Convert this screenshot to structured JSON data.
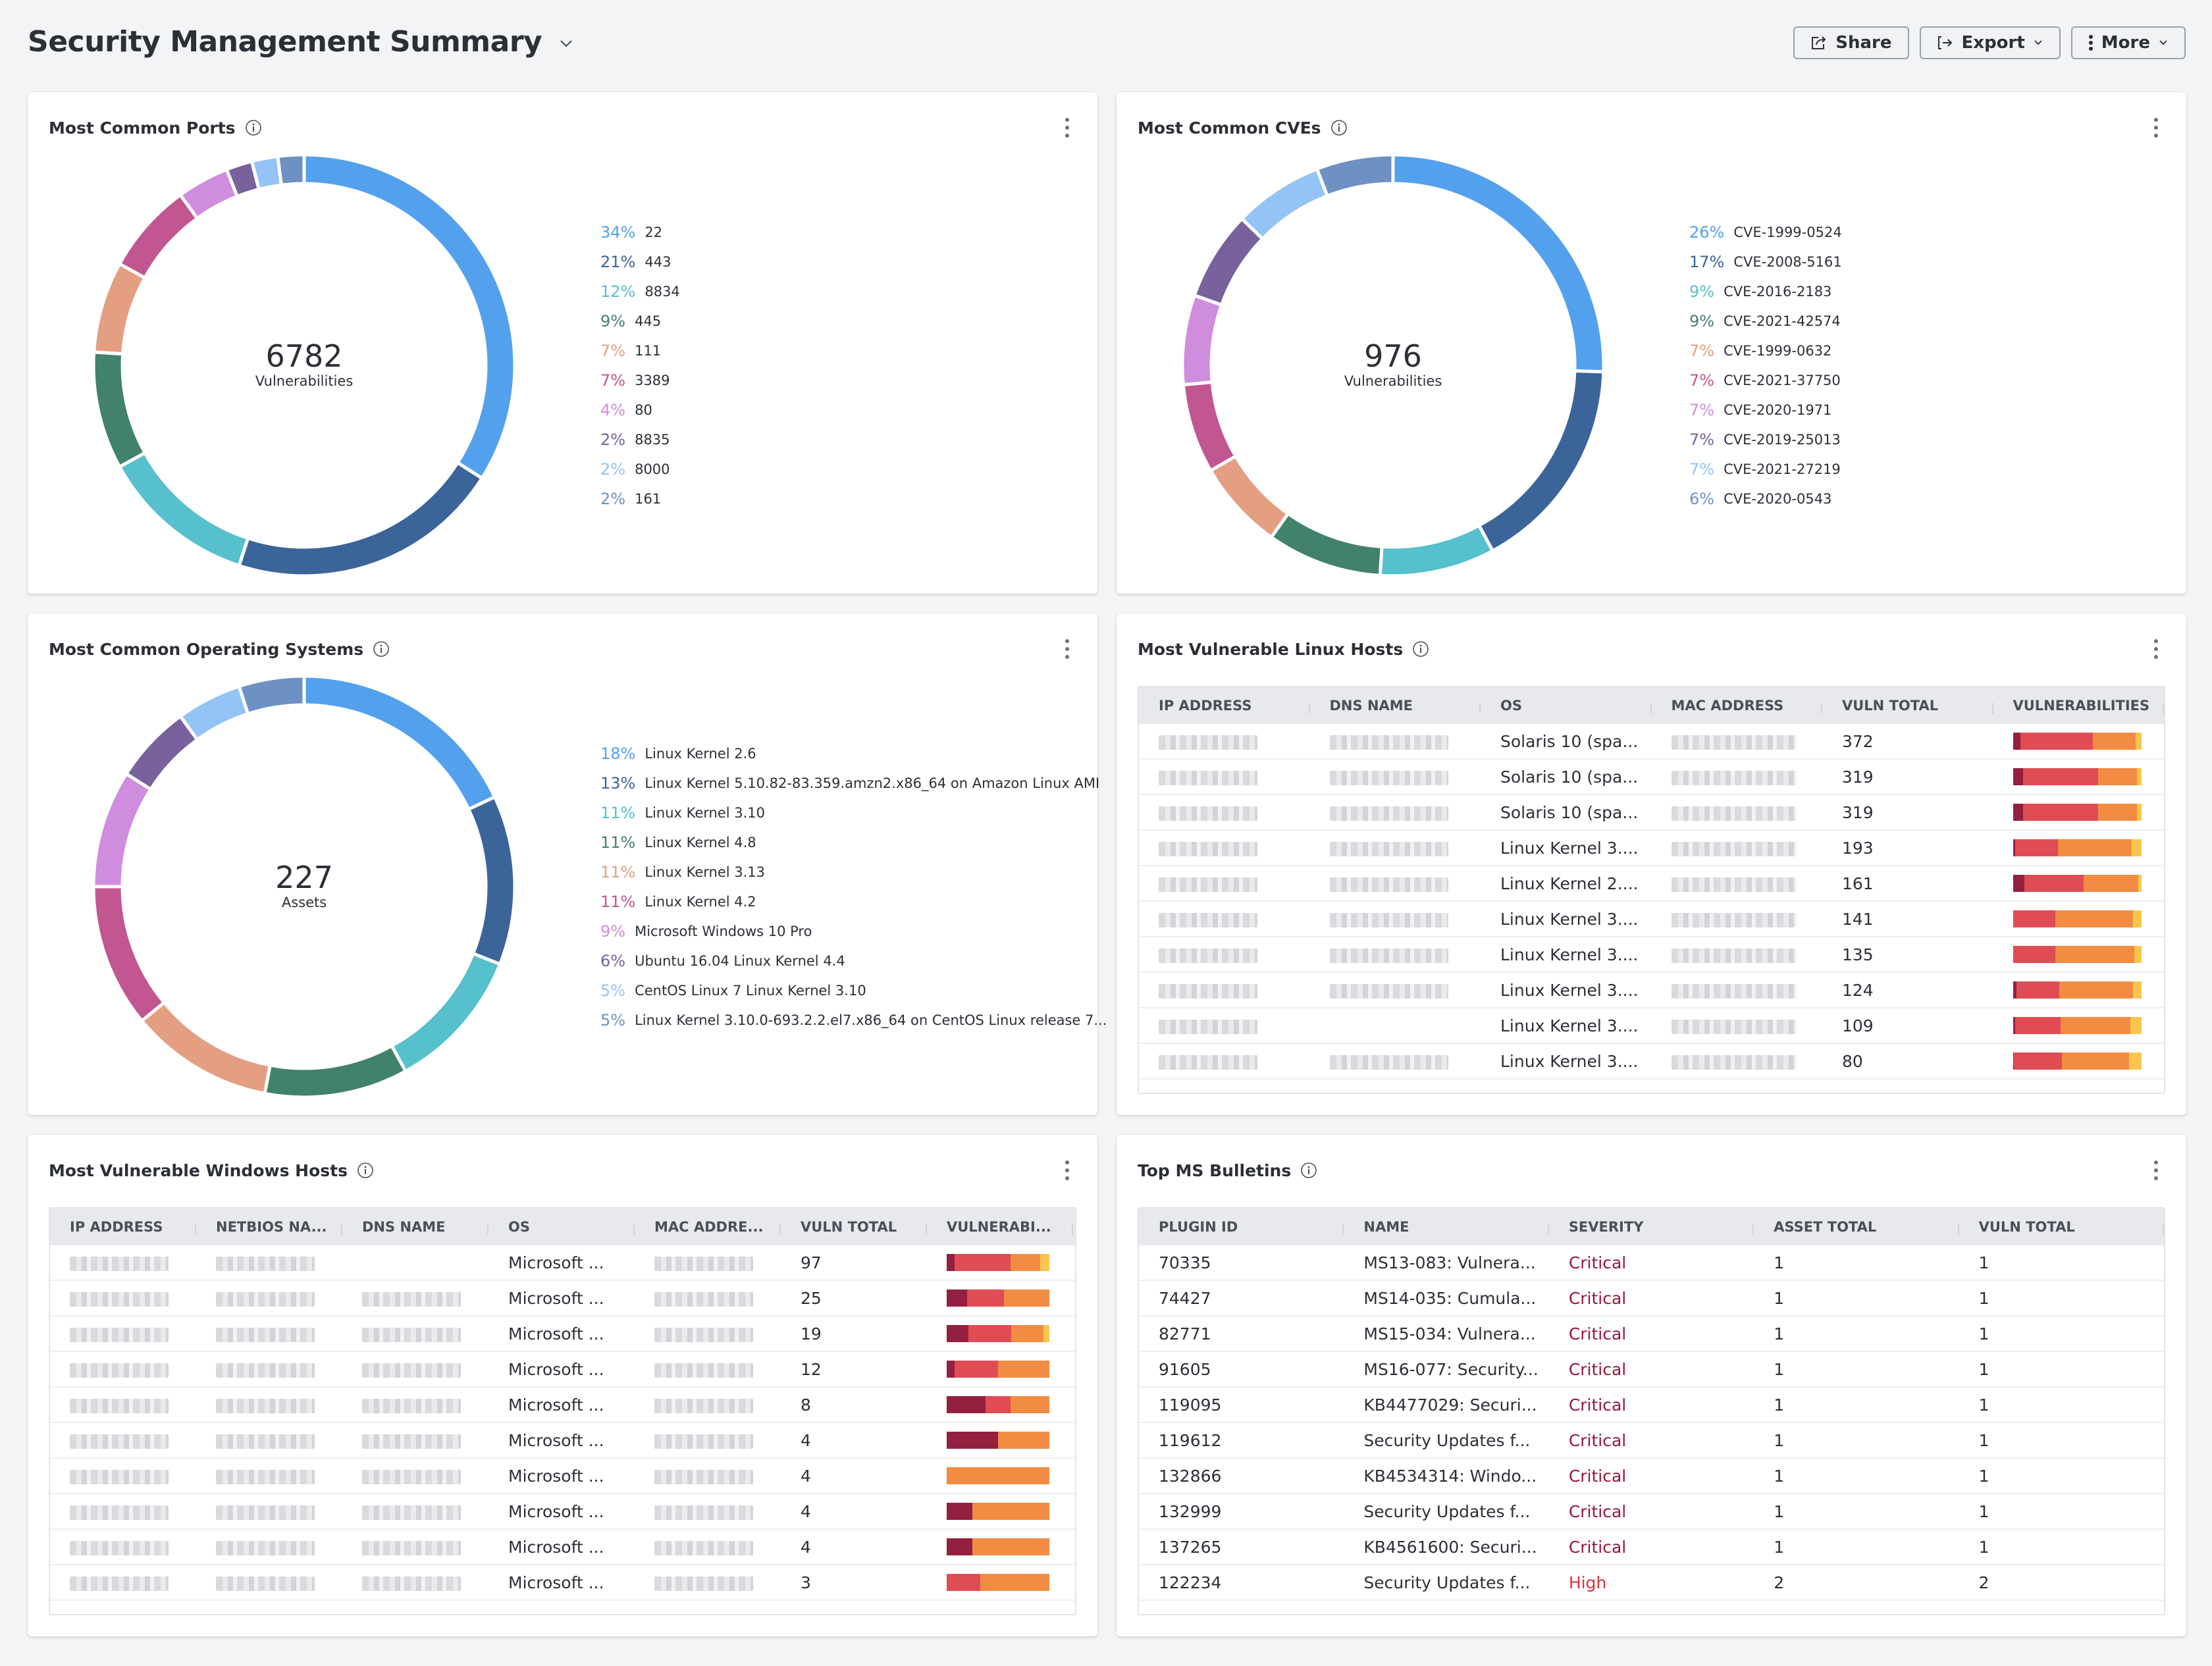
{
  "header": {
    "title": "Security Management Summary",
    "buttons": {
      "share": "Share",
      "export": "Export",
      "more": "More"
    }
  },
  "colors": {
    "palette": [
      "#53a1ed",
      "#3b6499",
      "#57c0cd",
      "#42816a",
      "#e49f82",
      "#c25690",
      "#d08cdd",
      "#78619c",
      "#93c4f5",
      "#6e91c4"
    ],
    "severity": {
      "critical": "#93203f",
      "high": "#e04c53",
      "medium": "#f28c42",
      "low": "#f8c64f"
    }
  },
  "chart_data": [
    {
      "type": "pie",
      "title": "Most Common Ports",
      "center_value": "6782",
      "center_label": "Vulnerabilities",
      "legend_position": "right",
      "categories": [
        "22",
        "443",
        "8834",
        "445",
        "111",
        "3389",
        "80",
        "8835",
        "8000",
        "161"
      ],
      "values": [
        34,
        21,
        12,
        9,
        7,
        7,
        4,
        2,
        2,
        2
      ],
      "percent_labels": [
        "34%",
        "21%",
        "12%",
        "9%",
        "7%",
        "7%",
        "4%",
        "2%",
        "2%",
        "2%"
      ]
    },
    {
      "type": "pie",
      "title": "Most Common CVEs",
      "center_value": "976",
      "center_label": "Vulnerabilities",
      "legend_position": "right",
      "categories": [
        "CVE-1999-0524",
        "CVE-2008-5161",
        "CVE-2016-2183",
        "CVE-2021-42574",
        "CVE-1999-0632",
        "CVE-2021-37750",
        "CVE-2020-1971",
        "CVE-2019-25013",
        "CVE-2021-27219",
        "CVE-2020-0543"
      ],
      "values": [
        26,
        17,
        9,
        9,
        7,
        7,
        7,
        7,
        7,
        6
      ],
      "percent_labels": [
        "26%",
        "17%",
        "9%",
        "9%",
        "7%",
        "7%",
        "7%",
        "7%",
        "7%",
        "6%"
      ]
    },
    {
      "type": "pie",
      "title": "Most Common Operating Systems",
      "center_value": "227",
      "center_label": "Assets",
      "legend_position": "right",
      "categories": [
        "Linux Kernel 2.6",
        "Linux Kernel 5.10.82-83.359.amzn2.x86_64 on Amazon Linux AMI",
        "Linux Kernel 3.10",
        "Linux Kernel 4.8",
        "Linux Kernel 3.13",
        "Linux Kernel 4.2",
        "Microsoft Windows 10 Pro",
        "Ubuntu 16.04 Linux Kernel 4.4",
        "CentOS Linux 7 Linux Kernel 3.10",
        "Linux Kernel 3.10.0-693.2.2.el7.x86_64 on CentOS Linux release 7..."
      ],
      "values": [
        18,
        13,
        11,
        11,
        11,
        11,
        9,
        6,
        5,
        5
      ],
      "percent_labels": [
        "18%",
        "13%",
        "11%",
        "11%",
        "11%",
        "11%",
        "9%",
        "6%",
        "5%",
        "5%"
      ]
    }
  ],
  "linux_hosts": {
    "title": "Most Vulnerable Linux Hosts",
    "columns": [
      "IP ADDRESS",
      "DNS NAME",
      "OS",
      "MAC ADDRESS",
      "VULN TOTAL",
      "VULNERABILITIES"
    ],
    "rows": [
      {
        "os": "Solaris 10 (spa...",
        "vuln_total": "372",
        "dns_redacted": true,
        "severity_mix": [
          0.06,
          0.56,
          0.33,
          0.05
        ]
      },
      {
        "os": "Solaris 10 (spa...",
        "vuln_total": "319",
        "dns_redacted": true,
        "severity_mix": [
          0.08,
          0.58,
          0.3,
          0.04
        ]
      },
      {
        "os": "Solaris 10 (spa...",
        "vuln_total": "319",
        "dns_redacted": true,
        "severity_mix": [
          0.08,
          0.58,
          0.3,
          0.04
        ]
      },
      {
        "os": "Linux Kernel 3....",
        "vuln_total": "193",
        "dns_redacted": true,
        "severity_mix": [
          0.02,
          0.33,
          0.57,
          0.08
        ]
      },
      {
        "os": "Linux Kernel 2....",
        "vuln_total": "161",
        "dns_redacted": true,
        "severity_mix": [
          0.09,
          0.46,
          0.42,
          0.03
        ]
      },
      {
        "os": "Linux Kernel 3....",
        "vuln_total": "141",
        "dns_redacted": true,
        "severity_mix": [
          0,
          0.33,
          0.6,
          0.07
        ]
      },
      {
        "os": "Linux Kernel 3....",
        "vuln_total": "135",
        "dns_redacted": true,
        "severity_mix": [
          0,
          0.33,
          0.61,
          0.06
        ]
      },
      {
        "os": "Linux Kernel 3....",
        "vuln_total": "124",
        "dns_redacted": true,
        "severity_mix": [
          0.03,
          0.33,
          0.57,
          0.07
        ]
      },
      {
        "os": "Linux Kernel 3....",
        "vuln_total": "109",
        "dns_redacted": false,
        "severity_mix": [
          0.02,
          0.35,
          0.54,
          0.09
        ]
      },
      {
        "os": "Linux Kernel 3....",
        "vuln_total": "80",
        "dns_redacted": true,
        "severity_mix": [
          0.01,
          0.37,
          0.52,
          0.1
        ]
      }
    ]
  },
  "windows_hosts": {
    "title": "Most Vulnerable Windows Hosts",
    "columns": [
      "IP ADDRESS",
      "NETBIOS NA...",
      "DNS NAME",
      "OS",
      "MAC ADDRE...",
      "VULN TOTAL",
      "VULNERABI..."
    ],
    "rows": [
      {
        "os": "Microsoft ...",
        "vuln_total": "97",
        "dns_redacted": false,
        "severity_mix": [
          0.08,
          0.54,
          0.29,
          0.09
        ]
      },
      {
        "os": "Microsoft ...",
        "vuln_total": "25",
        "dns_redacted": true,
        "severity_mix": [
          0.2,
          0.36,
          0.44,
          0
        ]
      },
      {
        "os": "Microsoft ...",
        "vuln_total": "19",
        "dns_redacted": true,
        "severity_mix": [
          0.21,
          0.42,
          0.31,
          0.06
        ]
      },
      {
        "os": "Microsoft ...",
        "vuln_total": "12",
        "dns_redacted": true,
        "severity_mix": [
          0.08,
          0.42,
          0.5,
          0
        ]
      },
      {
        "os": "Microsoft ...",
        "vuln_total": "8",
        "dns_redacted": true,
        "severity_mix": [
          0.375,
          0.245,
          0.38,
          0
        ]
      },
      {
        "os": "Microsoft ...",
        "vuln_total": "4",
        "dns_redacted": true,
        "severity_mix": [
          0.5,
          0,
          0.5,
          0
        ]
      },
      {
        "os": "Microsoft ...",
        "vuln_total": "4",
        "dns_redacted": true,
        "severity_mix": [
          0,
          0,
          1,
          0
        ]
      },
      {
        "os": "Microsoft ...",
        "vuln_total": "4",
        "dns_redacted": true,
        "severity_mix": [
          0.25,
          0,
          0.75,
          0
        ]
      },
      {
        "os": "Microsoft ...",
        "vuln_total": "4",
        "dns_redacted": true,
        "severity_mix": [
          0.25,
          0,
          0.75,
          0
        ]
      },
      {
        "os": "Microsoft ...",
        "vuln_total": "3",
        "dns_redacted": true,
        "severity_mix": [
          0,
          0.33,
          0.67,
          0
        ]
      }
    ]
  },
  "ms_bulletins": {
    "title": "Top MS Bulletins",
    "columns": [
      "PLUGIN ID",
      "NAME",
      "SEVERITY",
      "ASSET TOTAL",
      "VULN TOTAL"
    ],
    "rows": [
      {
        "plugin_id": "70335",
        "name": "MS13-083: Vulnera...",
        "severity": "Critical",
        "asset_total": "1",
        "vuln_total": "1"
      },
      {
        "plugin_id": "74427",
        "name": "MS14-035: Cumula...",
        "severity": "Critical",
        "asset_total": "1",
        "vuln_total": "1"
      },
      {
        "plugin_id": "82771",
        "name": "MS15-034: Vulnera...",
        "severity": "Critical",
        "asset_total": "1",
        "vuln_total": "1"
      },
      {
        "plugin_id": "91605",
        "name": "MS16-077: Security...",
        "severity": "Critical",
        "asset_total": "1",
        "vuln_total": "1"
      },
      {
        "plugin_id": "119095",
        "name": "KB4477029: Securi...",
        "severity": "Critical",
        "asset_total": "1",
        "vuln_total": "1"
      },
      {
        "plugin_id": "119612",
        "name": "Security Updates f...",
        "severity": "Critical",
        "asset_total": "1",
        "vuln_total": "1"
      },
      {
        "plugin_id": "132866",
        "name": "KB4534314: Windo...",
        "severity": "Critical",
        "asset_total": "1",
        "vuln_total": "1"
      },
      {
        "plugin_id": "132999",
        "name": "Security Updates f...",
        "severity": "Critical",
        "asset_total": "1",
        "vuln_total": "1"
      },
      {
        "plugin_id": "137265",
        "name": "KB4561600: Securi...",
        "severity": "Critical",
        "asset_total": "1",
        "vuln_total": "1"
      },
      {
        "plugin_id": "122234",
        "name": "Security Updates f...",
        "severity": "High",
        "asset_total": "2",
        "vuln_total": "2"
      }
    ]
  }
}
